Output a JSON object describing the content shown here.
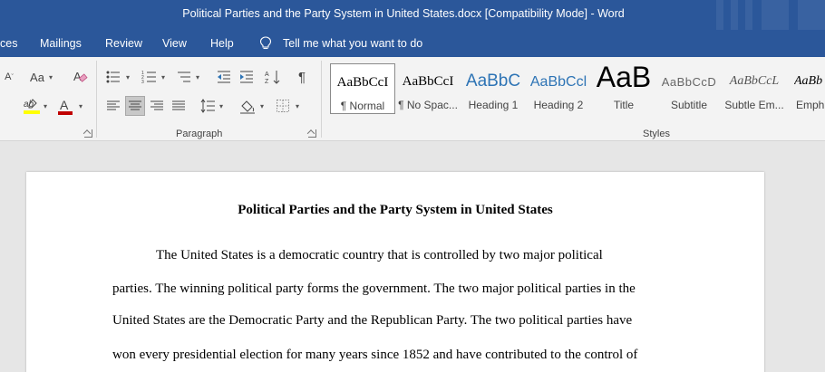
{
  "window": {
    "title": "Political Parties and the Party System in United States.docx [Compatibility Mode]  -  Word"
  },
  "menu": {
    "tabs": [
      {
        "label": "ces"
      },
      {
        "label": "Mailings"
      },
      {
        "label": "Review"
      },
      {
        "label": "View"
      },
      {
        "label": "Help"
      }
    ],
    "tell_me": "Tell me what you want to do"
  },
  "ribbon": {
    "font_group": {
      "change_case_label": "Aa",
      "grow_font_label": "A",
      "font_color_label": "A",
      "highlight_label": "ab"
    },
    "paragraph_group": {
      "label": "Paragraph",
      "show_marks_label": "¶"
    },
    "styles_group": {
      "label": "Styles",
      "styles": [
        {
          "preview": "AaBbCcI",
          "name": "¶ Normal"
        },
        {
          "preview": "AaBbCcI",
          "name": "¶ No Spac..."
        },
        {
          "preview": "AaBbC",
          "name": "Heading 1"
        },
        {
          "preview": "AaBbCcl",
          "name": "Heading 2"
        },
        {
          "preview": "AaB",
          "name": "Title"
        },
        {
          "preview": "AaBbCcD",
          "name": "Subtitle"
        },
        {
          "preview": "AaBbCcL",
          "name": "Subtle Em..."
        },
        {
          "preview": "AaBb",
          "name": "Emph"
        }
      ]
    },
    "colors": {
      "font_color": "#c00000",
      "highlight_color": "#ffff00"
    }
  },
  "document": {
    "title": "Political Parties and the Party System in United States",
    "lines": [
      "The United States is a democratic country that is controlled by two major political",
      "parties. The winning political party forms the government. The two major political parties in the",
      "United States are the Democratic Party and the Republican Party. The two political parties have",
      "won every presidential election for many years since 1852 and have contributed to the control of"
    ]
  },
  "colors": {
    "title_bar": "#2b579a",
    "ribbon_bg": "#f3f3f3",
    "doc_bg": "#e6e6e6",
    "heading_blue": "#2e74b5"
  }
}
